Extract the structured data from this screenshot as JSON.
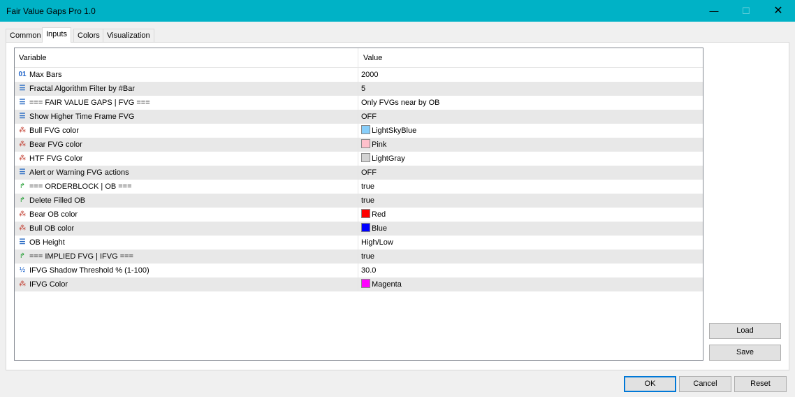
{
  "window": {
    "title": "Fair Value Gaps Pro 1.0",
    "min_glyph": "—",
    "max_glyph": "☐",
    "close_glyph": "✕"
  },
  "tabs": [
    {
      "label": "Common"
    },
    {
      "label": "Inputs",
      "active": true
    },
    {
      "label": "Colors"
    },
    {
      "label": "Visualization"
    }
  ],
  "grid": {
    "headers": {
      "variable": "Variable",
      "value": "Value"
    },
    "rows": [
      {
        "icon": "int-icon",
        "glyph": "01",
        "name": "Max Bars",
        "value": "2000"
      },
      {
        "icon": "enum-icon",
        "glyph": "☰",
        "name": "Fractal Algorithm Filter by #Bar",
        "value": "5"
      },
      {
        "icon": "enum-icon",
        "glyph": "☰",
        "name": "=== FAIR VALUE GAPS | FVG ===",
        "value": "Only FVGs near by OB"
      },
      {
        "icon": "enum-icon",
        "glyph": "☰",
        "name": "Show Higher Time Frame FVG",
        "value": "OFF"
      },
      {
        "icon": "color-icon",
        "glyph": "⁂",
        "name": "Bull FVG color",
        "value": "LightSkyBlue",
        "swatch": "#87cefa"
      },
      {
        "icon": "color-icon",
        "glyph": "⁂",
        "name": "Bear FVG color",
        "value": "Pink",
        "swatch": "#ffc0cb"
      },
      {
        "icon": "color-icon",
        "glyph": "⁂",
        "name": "HTF FVG Color",
        "value": "LightGray",
        "swatch": "#d3d3d3"
      },
      {
        "icon": "enum-icon",
        "glyph": "☰",
        "name": "Alert or Warning FVG actions",
        "value": "OFF"
      },
      {
        "icon": "bool-icon",
        "glyph": "↱",
        "name": "=== ORDERBLOCK | OB ===",
        "value": "true"
      },
      {
        "icon": "bool-icon",
        "glyph": "↱",
        "name": "Delete Filled OB",
        "value": "true"
      },
      {
        "icon": "color-icon",
        "glyph": "⁂",
        "name": "Bear OB color",
        "value": "Red",
        "swatch": "#ff0000"
      },
      {
        "icon": "color-icon",
        "glyph": "⁂",
        "name": "Bull OB color",
        "value": "Blue",
        "swatch": "#0000ff"
      },
      {
        "icon": "enum-icon",
        "glyph": "☰",
        "name": "OB Height",
        "value": "High/Low"
      },
      {
        "icon": "bool-icon",
        "glyph": "↱",
        "name": "=== IMPLIED FVG | IFVG ===",
        "value": "true"
      },
      {
        "icon": "double-icon",
        "glyph": "½",
        "name": "IFVG Shadow Threshold % (1-100)",
        "value": "30.0"
      },
      {
        "icon": "color-icon",
        "glyph": "⁂",
        "name": "IFVG Color",
        "value": "Magenta",
        "swatch": "#ff00ff"
      }
    ]
  },
  "side_buttons": {
    "load": "Load",
    "save": "Save"
  },
  "footer": {
    "ok": "OK",
    "cancel": "Cancel",
    "reset": "Reset"
  },
  "colors": {
    "titlebar": "#00b2c6",
    "ok_border": "#0078d7"
  }
}
